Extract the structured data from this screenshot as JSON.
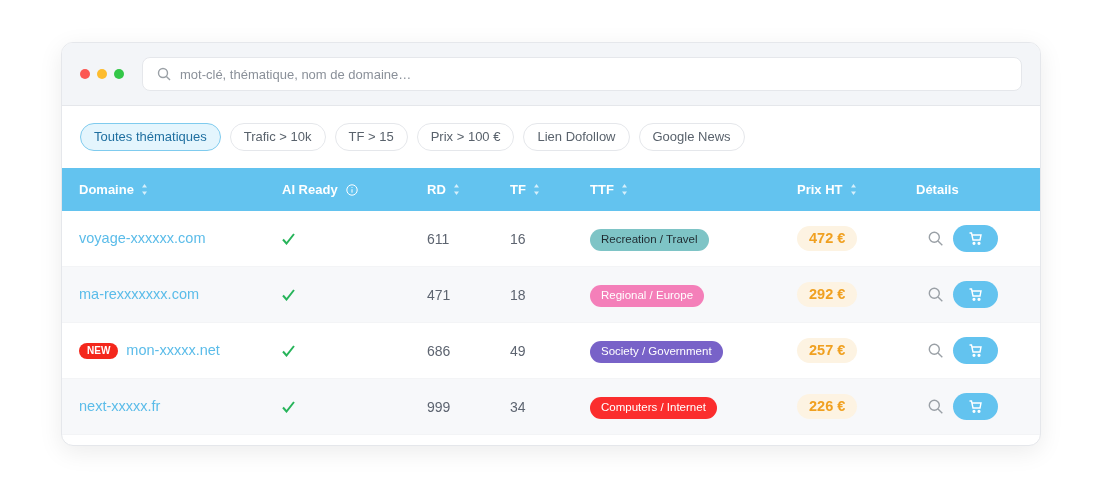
{
  "search": {
    "placeholder": "mot-clé, thématique, nom de domaine…"
  },
  "filters": [
    {
      "label": "Toutes thématiques",
      "selected": true
    },
    {
      "label": "Trafic > 10k",
      "selected": false
    },
    {
      "label": "TF > 15",
      "selected": false
    },
    {
      "label": "Prix > 100 €",
      "selected": false
    },
    {
      "label": "Lien Dofollow",
      "selected": false
    },
    {
      "label": "Google News",
      "selected": false
    }
  ],
  "table": {
    "columns": [
      {
        "label": "Domaine",
        "kind": "sortable"
      },
      {
        "label": "AI Ready",
        "kind": "info"
      },
      {
        "label": "RD",
        "kind": "sortable"
      },
      {
        "label": "TF",
        "kind": "sortable"
      },
      {
        "label": "TTF",
        "kind": "sortable"
      },
      {
        "label": "Prix HT",
        "kind": "sortable"
      },
      {
        "label": "Détails",
        "kind": "plain"
      }
    ],
    "rows": [
      {
        "domain": "voyage-xxxxxx.com",
        "new": false,
        "ai_ready": true,
        "rd": "611",
        "tf": "16",
        "ttf": {
          "label": "Recreation / Travel",
          "color": "#7ec4c6"
        },
        "price": "472 €"
      },
      {
        "domain": "ma-rexxxxxxx.com",
        "new": false,
        "ai_ready": true,
        "rd": "471",
        "tf": "18",
        "ttf": {
          "label": "Regional / Europe",
          "color": "#f47fb9"
        },
        "price": "292 €"
      },
      {
        "domain": "mon-xxxxx.net",
        "new": true,
        "badge": "NEW",
        "ai_ready": true,
        "rd": "686",
        "tf": "49",
        "ttf": {
          "label": "Society / Government",
          "color": "#7862c8"
        },
        "price": "257 €"
      },
      {
        "domain": "next-xxxxx.fr",
        "new": false,
        "ai_ready": true,
        "rd": "999",
        "tf": "34",
        "ttf": {
          "label": "Computers / Internet",
          "color": "#fb2d2d"
        },
        "price": "226 €"
      }
    ]
  }
}
